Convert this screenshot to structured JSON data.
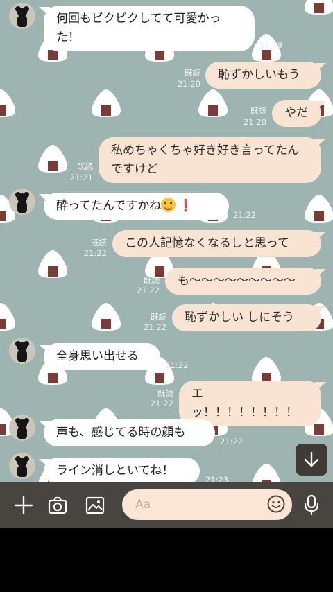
{
  "colors": {
    "wallpaper": "#9eb4b1",
    "incoming_bubble": "#ffffff",
    "outgoing_bubble": "#f9e4d4",
    "input_bar": "#48443f"
  },
  "messages": [
    {
      "dir": "in",
      "text": "何回もビクビクしてて可愛かった！",
      "time": "21:19",
      "read": ""
    },
    {
      "dir": "out",
      "text": "恥ずかしいもう",
      "time": "21:20",
      "read": "既読"
    },
    {
      "dir": "out",
      "text": "やだ",
      "time": "21:20",
      "read": "既読"
    },
    {
      "dir": "out",
      "text": "私めちゃくちゃ好き好き言ってたんですけど",
      "time": "21:21",
      "read": "既読"
    },
    {
      "dir": "in",
      "text": "酔ってたんですかね",
      "emoji": [
        "smiling-face-emoji",
        "exclamation-emoji"
      ],
      "time": "21:22",
      "read": ""
    },
    {
      "dir": "out",
      "text": "この人記憶なくなるしと思って",
      "time": "21:22",
      "read": "既読"
    },
    {
      "dir": "out",
      "text": "も〜〜〜〜〜〜〜〜〜",
      "time": "21:22",
      "read": "既読"
    },
    {
      "dir": "out",
      "text": "恥ずかしい しにそう",
      "time": "21:22",
      "read": "既読"
    },
    {
      "dir": "in",
      "text": "全身思い出せる",
      "time": "21:22",
      "read": ""
    },
    {
      "dir": "out",
      "text": "エッ！！！！！！！！",
      "time": "21:22",
      "read": "既読"
    },
    {
      "dir": "in",
      "text": "声も、感じてる時の顔も",
      "time": "21:22",
      "read": ""
    },
    {
      "dir": "in",
      "text": "ライン消しといてね！",
      "time": "21:23",
      "read": ""
    }
  ],
  "input": {
    "placeholder": "Aa"
  },
  "icons": {
    "add": "plus-icon",
    "camera": "camera-icon",
    "image": "image-icon",
    "sticker": "smiley-icon",
    "mic": "microphone-icon",
    "scroll": "arrow-down-icon"
  }
}
